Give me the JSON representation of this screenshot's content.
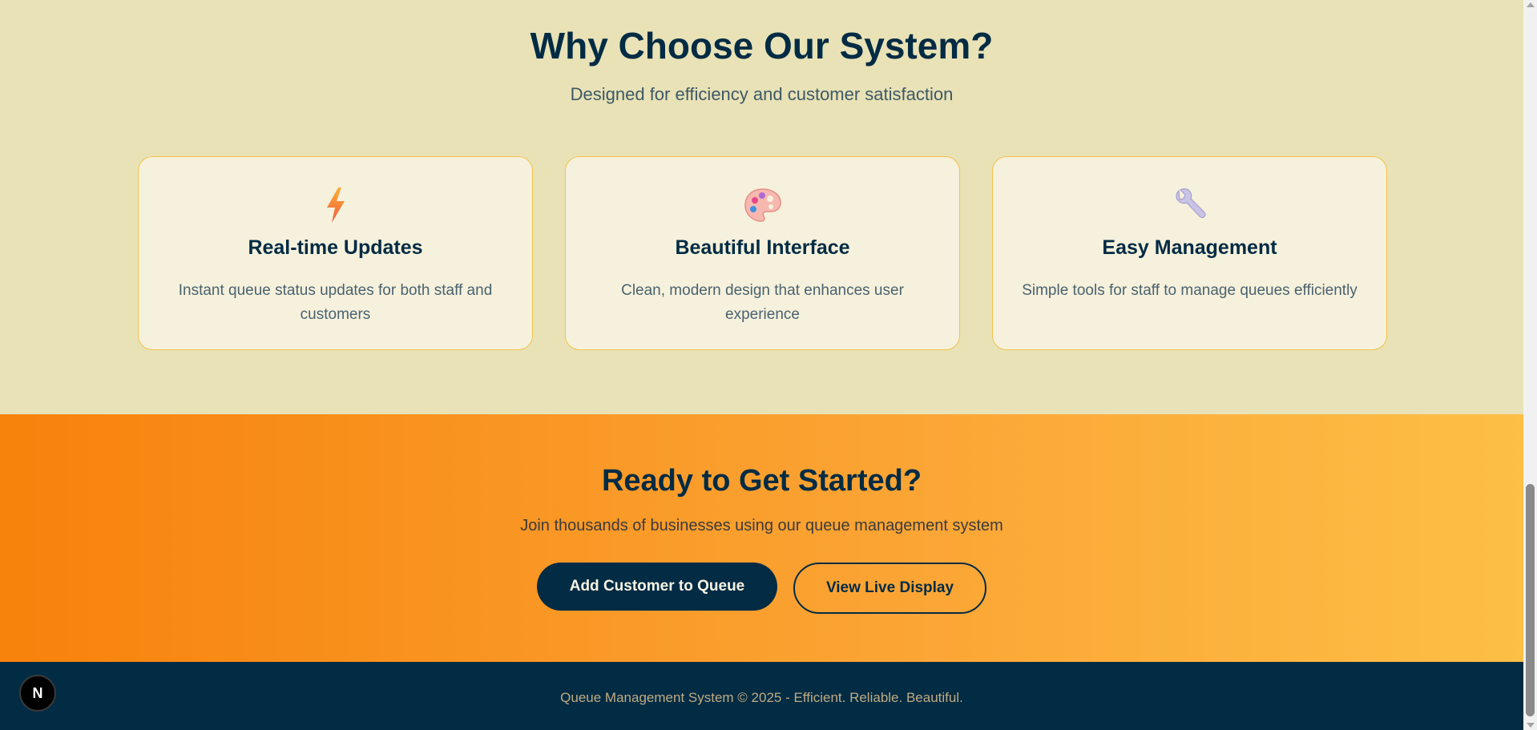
{
  "features": {
    "title": "Why Choose Our System?",
    "subtitle": "Designed for efficiency and customer satisfaction",
    "cards": [
      {
        "icon": "lightning-icon",
        "title": "Real-time Updates",
        "description": "Instant queue status updates for both staff and customers"
      },
      {
        "icon": "palette-icon",
        "title": "Beautiful Interface",
        "description": "Clean, modern design that enhances user experience"
      },
      {
        "icon": "wrench-icon",
        "title": "Easy Management",
        "description": "Simple tools for staff to manage queues efficiently"
      }
    ]
  },
  "cta": {
    "title": "Ready to Get Started?",
    "subtitle": "Join thousands of businesses using our queue management system",
    "primary_button": "Add Customer to Queue",
    "secondary_button": "View Live Display"
  },
  "footer": {
    "text": "Queue Management System © 2025 - Efficient. Reliable. Beautiful.",
    "badge": "N"
  },
  "colors": {
    "navy": "#022b44",
    "cream_bg": "#e8e2b6",
    "card_bg": "#f6f1dc",
    "card_border": "#f5c24a",
    "orange_start": "#f7820c",
    "orange_end": "#fdbf46",
    "footer_text": "#c0ab82"
  }
}
